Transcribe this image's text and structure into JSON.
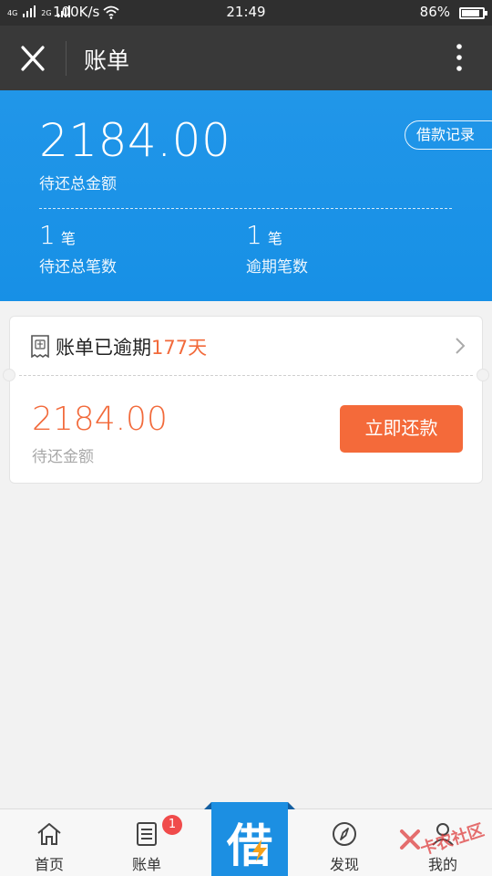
{
  "status_bar": {
    "signal1": "4G",
    "signal2": "2G",
    "net_speed": "100K/s",
    "time": "21:49",
    "battery": "86%"
  },
  "titlebar": {
    "title": "账单",
    "close_icon": "close-icon",
    "more_icon": "more-vertical-icon"
  },
  "summary": {
    "total_amount": "2184.00",
    "total_amount_label": "待还总金额",
    "record_button": "借款记录",
    "pending_count": "1",
    "pending_unit": "笔",
    "pending_label": "待还总笔数",
    "overdue_count": "1",
    "overdue_unit": "笔",
    "overdue_label": "逾期笔数"
  },
  "bill": {
    "status_prefix": "账单已逾期",
    "overdue_days": "177天",
    "amount": "2184.00",
    "amount_label": "待还金额",
    "repay_button": "立即还款",
    "accent_color": "#f26a3b"
  },
  "nav": {
    "items": [
      {
        "label": "首页",
        "icon": "home-icon"
      },
      {
        "label": "账单",
        "icon": "bill-icon",
        "badge": "1"
      },
      {
        "label": "借",
        "icon": "borrow-icon"
      },
      {
        "label": "发现",
        "icon": "compass-icon"
      },
      {
        "label": "我的",
        "icon": "user-icon"
      }
    ]
  },
  "watermark": "卡农社区",
  "colors": {
    "header_blue": "#1a8fe6",
    "titlebar": "#393939",
    "orange": "#f46a3a"
  }
}
